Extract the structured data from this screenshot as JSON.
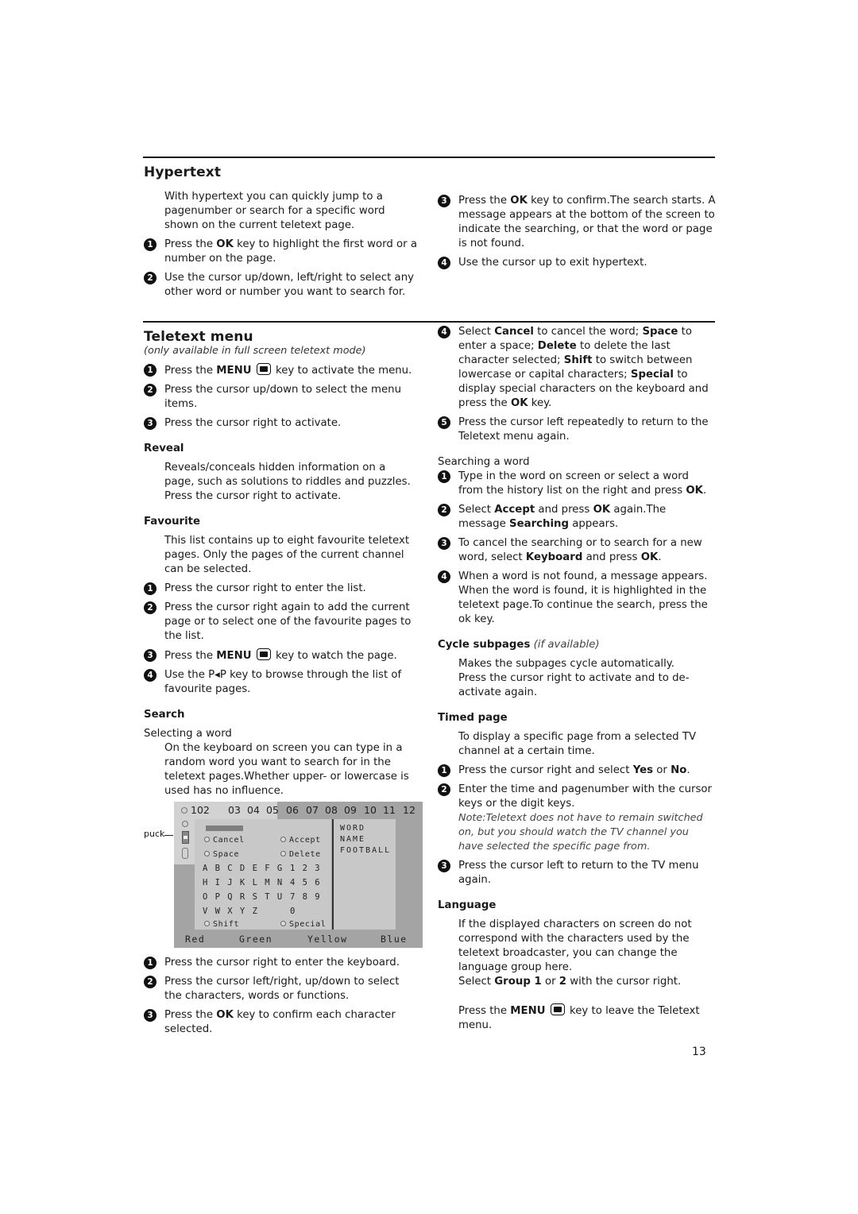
{
  "hypertext": {
    "title": "Hypertext",
    "intro": "With hypertext you can quickly jump to a pagenumber or search for a specific word shown on the current teletext page.",
    "steps": [
      {
        "n": "1",
        "pre": "Press the ",
        "bold": "OK",
        "post": " key to highlight the first word or a number on the page."
      },
      {
        "n": "2",
        "text": "Use the cursor up/down, left/right to select any other word or number you want to search for."
      },
      {
        "n": "3",
        "pre": "Press the ",
        "bold": "OK",
        "post": " key to confirm.The search starts. A message appears at the bottom of the screen to indicate the searching, or that the word or page is not found."
      },
      {
        "n": "4",
        "text": "Use the cursor up to exit hypertext."
      }
    ]
  },
  "teletext_menu": {
    "title": "Teletext menu",
    "subtitle": "(only available in full screen teletext mode)",
    "steps": [
      {
        "n": "1",
        "pre": "Press the ",
        "bold": "MENU",
        "post": " key to activate the menu."
      },
      {
        "n": "2",
        "text": "Press the cursor up/down to select the menu items."
      },
      {
        "n": "3",
        "text": "Press the cursor right to activate."
      }
    ],
    "reveal": {
      "title": "Reveal",
      "text1": "Reveals/conceals hidden information on a page, such as solutions to riddles and puzzles.",
      "text2": "Press the cursor right to activate."
    },
    "favourite": {
      "title": "Favourite",
      "intro": "This list contains up to eight favourite teletext pages. Only the pages of the current channel can be selected.",
      "steps": [
        {
          "n": "1",
          "text": "Press the cursor right to enter the list."
        },
        {
          "n": "2",
          "text": "Press the cursor right again to add the current page or to select one of the favourite pages to the list."
        },
        {
          "n": "3",
          "pre": "Press the ",
          "bold": "MENU",
          "post": " key to watch the page."
        },
        {
          "n": "4",
          "pre": "Use the ",
          "key": "P◂P",
          "post": " key to browse through the list of favourite pages."
        }
      ]
    },
    "search": {
      "title": "Search",
      "selecting_label": "Selecting a word",
      "intro": "On the keyboard on screen you can type in a random word you want to search for in the teletext pages.Whether upper- or lowercase is used has no influence.",
      "steps": [
        {
          "n": "1",
          "text": "Press the cursor right to enter the keyboard."
        },
        {
          "n": "2",
          "text": "Press the cursor left/right, up/down to select the characters, words or functions."
        },
        {
          "n": "3",
          "pre": "Press the ",
          "bold": "OK",
          "post": " key to confirm each character selected."
        }
      ],
      "step4": {
        "n": "4",
        "parts": [
          "Select ",
          "Cancel",
          " to cancel the word; ",
          "Space",
          " to enter a space; ",
          "Delete",
          " to delete the last character selected; ",
          "Shift",
          " to switch between lowercase or capital characters; ",
          "Special",
          " to display special characters on the keyboard and press the ",
          "OK",
          " key."
        ]
      },
      "step5": {
        "n": "5",
        "text": "Press the cursor left repeatedly to return to the Teletext menu again."
      },
      "searching_label": "Searching a word",
      "searching_steps": [
        {
          "n": "1",
          "parts": [
            "Type in the word on screen or select a word from the history list on the right and press ",
            "OK",
            "."
          ]
        },
        {
          "n": "2",
          "parts": [
            "Select ",
            "Accept",
            " and press ",
            "OK",
            " again.The message ",
            "Searching",
            " appears."
          ]
        },
        {
          "n": "3",
          "parts": [
            "To cancel the searching or to search for a new word, select ",
            "Keyboard",
            " and press ",
            "OK",
            "."
          ]
        },
        {
          "n": "4",
          "parts": [
            "When a word is not found, a message appears. When the word is found, it is highlighted in the teletext page.To continue the search, press the ok key."
          ]
        }
      ]
    },
    "cycle": {
      "title": "Cycle subpages",
      "qualifier": "(if available)",
      "text1": "Makes the subpages cycle automatically.",
      "text2": "Press the cursor right to activate and to de-activate again."
    },
    "timed": {
      "title": "Timed page",
      "intro": "To display a specific page from a selected TV channel at a certain time.",
      "steps": [
        {
          "n": "1",
          "parts": [
            "Press the cursor right and select ",
            "Yes",
            " or ",
            "No",
            "."
          ]
        },
        {
          "n": "2",
          "parts": [
            "Enter the time and pagenumber with the cursor keys or the digit keys."
          ]
        },
        {
          "n": "3",
          "parts": [
            "Press the cursor left to return to the TV menu again."
          ]
        }
      ],
      "note": "Note:Teletext does not have to remain switched on, but you should watch the TV channel you have selected the specific page from."
    },
    "language": {
      "title": "Language",
      "text": "If the displayed characters on screen do not correspond with the characters used by the teletext broadcaster, you can change the language group here.",
      "select_parts": [
        "Select ",
        "Group 1",
        " or ",
        "2",
        " with the cursor right."
      ],
      "leave_pre": "Press the ",
      "leave_bold": "MENU",
      "leave_post": " key to leave the Teletext menu."
    }
  },
  "teletext_screen": {
    "puck_label": "puck",
    "pages": [
      "102",
      "03",
      "04",
      "05",
      "06",
      "07",
      "08",
      "09",
      "10",
      "11",
      "12"
    ],
    "functions": {
      "cancel": "Cancel",
      "accept": "Accept",
      "space": "Space",
      "delete": "Delete",
      "shift": "Shift",
      "special": "Special"
    },
    "rows": [
      {
        "letters": "A B C D E F G",
        "digits": "1 2 3"
      },
      {
        "letters": "H I J K L M N",
        "digits": "4 5 6"
      },
      {
        "letters": "O P Q R S T U",
        "digits": "7 8 9"
      },
      {
        "letters": "V W X Y Z",
        "digits": "0"
      }
    ],
    "history": [
      "WORD",
      "NAME",
      "FOOTBALL"
    ],
    "color_keys": [
      "Red",
      "Green",
      "Yellow",
      "Blue"
    ]
  },
  "page_number": "13"
}
